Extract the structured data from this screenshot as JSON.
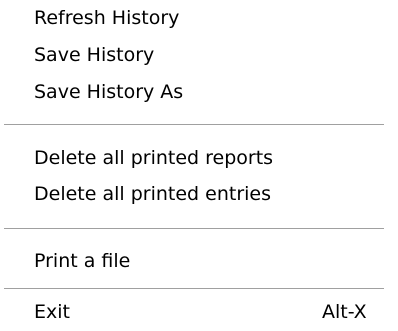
{
  "menu": {
    "groups": [
      [
        {
          "label": "Refresh History"
        },
        {
          "label": "Save History"
        },
        {
          "label": "Save History As"
        }
      ],
      [
        {
          "label": "Delete all printed reports"
        },
        {
          "label": "Delete all printed entries"
        }
      ],
      [
        {
          "label": "Print a file"
        }
      ],
      [
        {
          "label": "Exit",
          "shortcut": "Alt-X"
        }
      ]
    ]
  }
}
